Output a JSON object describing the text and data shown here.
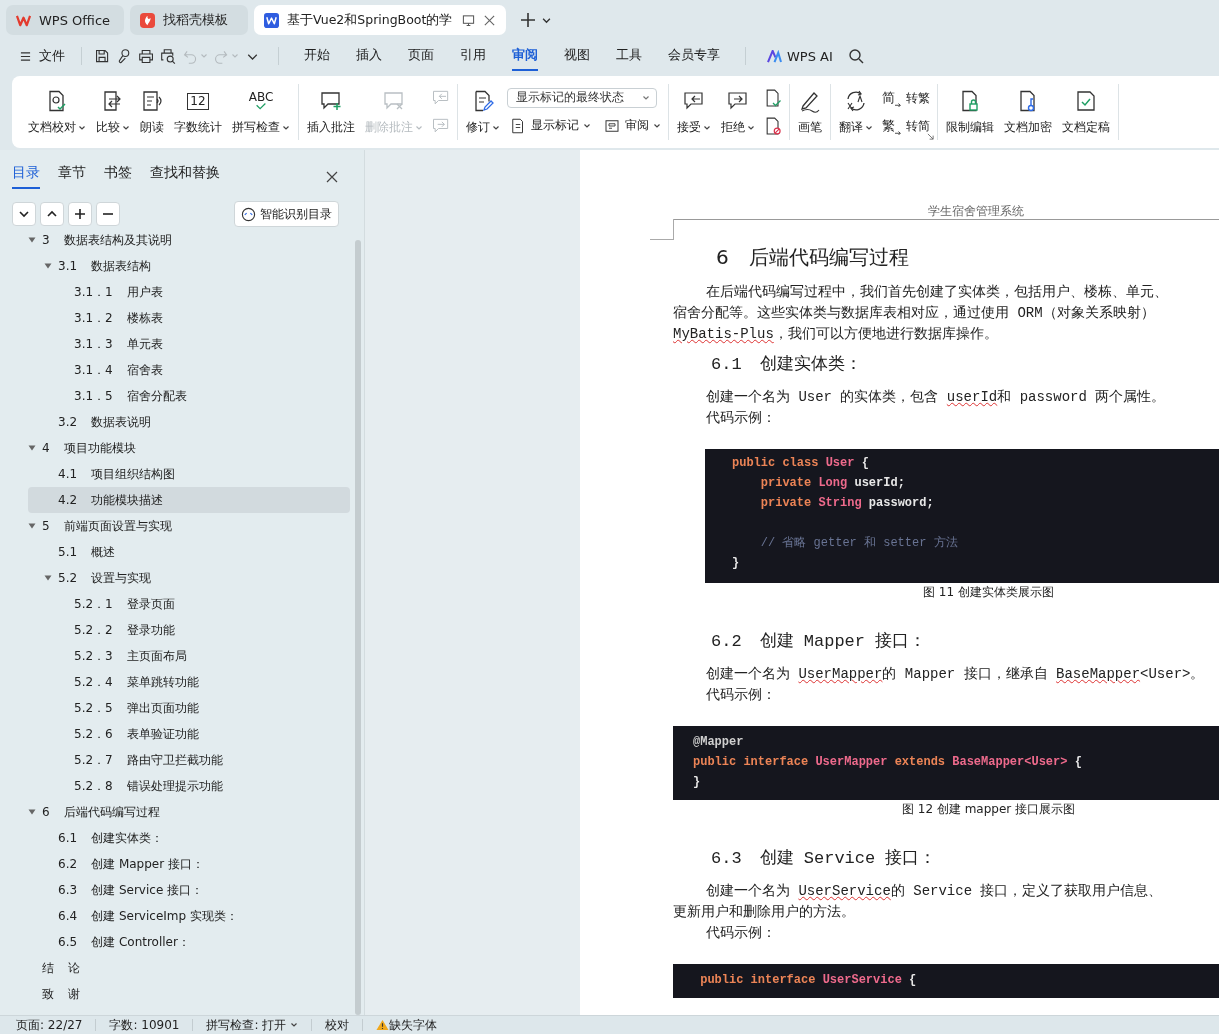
{
  "tabs": [
    {
      "kind": "app",
      "label": "WPS Office",
      "selected": false
    },
    {
      "kind": "template",
      "label": "找稻壳模板",
      "selected": false
    },
    {
      "kind": "writer",
      "label": "基于Vue2和SpringBoot的学",
      "selected": true
    }
  ],
  "menu": {
    "file_label": "文件",
    "quick_access": [
      {
        "disabled": false
      },
      {
        "disabled": false
      },
      {
        "disabled": false
      },
      {
        "disabled": false
      },
      {
        "disabled": true
      },
      {
        "disabled": true
      },
      {
        "disabled": false
      }
    ],
    "tabs": [
      {
        "label": "开始",
        "selected": false
      },
      {
        "label": "插入",
        "selected": false
      },
      {
        "label": "页面",
        "selected": false
      },
      {
        "label": "引用",
        "selected": false
      },
      {
        "label": "审阅",
        "selected": true
      },
      {
        "label": "视图",
        "selected": false
      },
      {
        "label": "工具",
        "selected": false
      },
      {
        "label": "会员专享",
        "selected": false
      }
    ],
    "ai_label": "WPS AI"
  },
  "ribbon": {
    "groups": [
      {
        "launcher": false,
        "columns": [
          [
            [
              {
                "kind": "big",
                "label": "文档校对",
                "caret": true,
                "disabled": false
              }
            ]
          ],
          [
            [
              {
                "kind": "big",
                "label": "比较",
                "caret": true,
                "disabled": false
              }
            ]
          ],
          [
            [
              {
                "kind": "big",
                "label": "朗读",
                "caret": false,
                "disabled": false
              }
            ]
          ],
          [
            [
              {
                "kind": "big",
                "label": "字数统计",
                "icon_text": "12",
                "caret": false,
                "disabled": false
              }
            ]
          ],
          [
            [
              {
                "kind": "big",
                "label": "拼写检查",
                "icon_text": "ABC",
                "caret": true,
                "disabled": false
              }
            ]
          ]
        ]
      },
      {
        "launcher": false,
        "columns": [
          [
            [
              {
                "kind": "big",
                "label": "插入批注",
                "caret": false,
                "disabled": false
              }
            ]
          ],
          [
            [
              {
                "kind": "big",
                "label": "删除批注",
                "caret": true,
                "disabled": true
              }
            ]
          ],
          [
            [
              {
                "kind": "icon",
                "disabled": true
              }
            ],
            [
              {
                "kind": "icon",
                "disabled": true
              }
            ]
          ]
        ]
      },
      {
        "launcher": false,
        "columns": [
          [
            [
              {
                "kind": "big",
                "label": "修订",
                "caret": true,
                "disabled": false
              }
            ]
          ],
          [
            [
              {
                "kind": "select",
                "value": "显示标记的最终状态"
              }
            ],
            [
              {
                "kind": "small",
                "label": "显示标记",
                "caret": true,
                "disabled": false
              },
              {
                "kind": "small",
                "label": "审阅",
                "caret": true,
                "disabled": false
              }
            ]
          ]
        ]
      },
      {
        "launcher": false,
        "columns": [
          [
            [
              {
                "kind": "big",
                "label": "接受",
                "caret": true,
                "disabled": false
              }
            ]
          ],
          [
            [
              {
                "kind": "big",
                "label": "拒绝",
                "caret": true,
                "disabled": false
              }
            ]
          ],
          [
            [
              {
                "kind": "icon",
                "disabled": false
              }
            ],
            [
              {
                "kind": "icon",
                "disabled": false
              }
            ]
          ]
        ]
      },
      {
        "launcher": false,
        "columns": [
          [
            [
              {
                "kind": "big",
                "label": "画笔",
                "caret": false,
                "disabled": false
              }
            ]
          ]
        ]
      },
      {
        "launcher": true,
        "columns": [
          [
            [
              {
                "kind": "big",
                "label": "翻译",
                "caret": true,
                "disabled": false
              }
            ]
          ],
          [
            [
              {
                "kind": "small",
                "label": "转繁",
                "icon_text": "简",
                "caret": false,
                "disabled": false
              }
            ],
            [
              {
                "kind": "small",
                "label": "转简",
                "icon_text": "繁",
                "caret": false,
                "disabled": false
              }
            ]
          ]
        ]
      },
      {
        "launcher": false,
        "columns": [
          [
            [
              {
                "kind": "big",
                "label": "限制编辑",
                "caret": false,
                "disabled": false
              }
            ]
          ],
          [
            [
              {
                "kind": "big",
                "label": "文档加密",
                "caret": false,
                "disabled": false
              }
            ]
          ],
          [
            [
              {
                "kind": "big",
                "label": "文档定稿",
                "caret": false,
                "disabled": false
              }
            ]
          ]
        ]
      }
    ]
  },
  "navigation": {
    "tabs": [
      {
        "label": "目录",
        "selected": true
      },
      {
        "label": "章节",
        "selected": false
      },
      {
        "label": "书签",
        "selected": false
      },
      {
        "label": "查找和替换",
        "selected": false
      }
    ],
    "smart_button": "智能识别目录",
    "outline": [
      {
        "num": "3",
        "title": "数据表结构及其说明",
        "selected": false,
        "expanded": true,
        "children": [
          {
            "num": "3.1",
            "title": "数据表结构",
            "selected": false,
            "expanded": true,
            "children": [
              {
                "num": "3.1．1",
                "title": "用户表",
                "selected": false
              },
              {
                "num": "3.1．2",
                "title": "楼栋表",
                "selected": false
              },
              {
                "num": "3.1．3",
                "title": "单元表",
                "selected": false
              },
              {
                "num": "3.1．4",
                "title": "宿舍表",
                "selected": false
              },
              {
                "num": "3.1．5",
                "title": "宿舍分配表",
                "selected": false
              }
            ]
          },
          {
            "num": "3.2",
            "title": "数据表说明",
            "selected": false
          }
        ]
      },
      {
        "num": "4",
        "title": "项目功能模块",
        "selected": false,
        "expanded": true,
        "children": [
          {
            "num": "4.1",
            "title": "项目组织结构图",
            "selected": false
          },
          {
            "num": "4.2",
            "title": "功能模块描述",
            "selected": true
          }
        ]
      },
      {
        "num": "5",
        "title": "前端页面设置与实现",
        "selected": false,
        "expanded": true,
        "children": [
          {
            "num": "5.1",
            "title": "概述",
            "selected": false
          },
          {
            "num": "5.2",
            "title": "设置与实现",
            "selected": false,
            "expanded": true,
            "children": [
              {
                "num": "5.2．1",
                "title": "登录页面",
                "selected": false
              },
              {
                "num": "5.2．2",
                "title": "登录功能",
                "selected": false
              },
              {
                "num": "5.2．3",
                "title": "主页面布局",
                "selected": false
              },
              {
                "num": "5.2．4",
                "title": "菜单跳转功能",
                "selected": false
              },
              {
                "num": "5.2．5",
                "title": "弹出页面功能",
                "selected": false
              },
              {
                "num": "5.2．6",
                "title": "表单验证功能",
                "selected": false
              },
              {
                "num": "5.2．7",
                "title": "路由守卫拦截功能",
                "selected": false
              },
              {
                "num": "5.2．8",
                "title": "错误处理提示功能",
                "selected": false
              }
            ]
          }
        ]
      },
      {
        "num": "6",
        "title": "后端代码编写过程",
        "selected": false,
        "expanded": true,
        "children": [
          {
            "num": "6.1",
            "title": "创建实体类：",
            "selected": false
          },
          {
            "num": "6.2",
            "title": "创建 Mapper 接口：",
            "selected": false
          },
          {
            "num": "6.3",
            "title": "创建 Service 接口：",
            "selected": false
          },
          {
            "num": "6.4",
            "title": "创建 ServiceImp 实现类：",
            "selected": false
          },
          {
            "num": "6.5",
            "title": "创建 Controller：",
            "selected": false
          }
        ]
      },
      {
        "num": "结",
        "title": "论",
        "selected": false
      },
      {
        "num": "致",
        "title": "谢",
        "selected": false
      }
    ]
  },
  "document": {
    "header": "学生宿舍管理系统",
    "blocks": [
      {
        "kind": "heading1",
        "num": "6",
        "title": "后端代码编写过程"
      },
      {
        "kind": "para",
        "lines": [
          {
            "indented": true,
            "segments": [
              {
                "text": "在后端代码编写过程中，我们首先创建了实体类，包括用户、楼栋、单元、",
                "misspelled": false
              }
            ]
          },
          {
            "indented": false,
            "segments": [
              {
                "text": "宿舍分配等。这些实体类与数据库表相对应，通过使用 ORM（对象关系映射）",
                "misspelled": false
              }
            ]
          },
          {
            "indented": false,
            "segments": [
              {
                "text": "MyBatis-Plus",
                "misspelled": true
              },
              {
                "text": "，我们可以方便地进行数据库操作。",
                "misspelled": false
              }
            ]
          }
        ]
      },
      {
        "kind": "heading2",
        "num": "6.1",
        "title": "创建实体类："
      },
      {
        "kind": "para",
        "lines": [
          {
            "indented": true,
            "segments": [
              {
                "text": "创建一个名为 User 的实体类，包含 ",
                "misspelled": false
              },
              {
                "text": "userId",
                "misspelled": true
              },
              {
                "text": "和 password 两个属性。",
                "misspelled": false
              }
            ]
          },
          {
            "indented": true,
            "segments": [
              {
                "text": "代码示例：",
                "misspelled": false
              }
            ]
          }
        ]
      },
      {
        "kind": "code",
        "indented": true,
        "lines": [
          {
            "kind": "code",
            "tokens": [
              {
                "text": "public class ",
                "kind": "keyword"
              },
              {
                "text": "User",
                "kind": "type"
              },
              {
                "text": " {",
                "kind": "plain"
              }
            ]
          },
          {
            "kind": "code",
            "tokens": [
              {
                "text": "    private ",
                "kind": "keyword"
              },
              {
                "text": "Long",
                "kind": "type"
              },
              {
                "text": " userId;",
                "kind": "plain"
              }
            ]
          },
          {
            "kind": "code",
            "tokens": [
              {
                "text": "    private ",
                "kind": "keyword"
              },
              {
                "text": "String",
                "kind": "type"
              },
              {
                "text": " password;",
                "kind": "plain"
              }
            ]
          },
          {
            "kind": "blank"
          },
          {
            "kind": "code",
            "tokens": [
              {
                "text": "    // 省略 getter 和 setter 方法",
                "kind": "comment"
              }
            ]
          },
          {
            "kind": "code",
            "tokens": [
              {
                "text": "}",
                "kind": "plain"
              }
            ]
          }
        ]
      },
      {
        "kind": "caption",
        "text": "图  11 创建实体类展示图"
      },
      {
        "kind": "heading2",
        "num": "6.2",
        "title": "创建 Mapper 接口："
      },
      {
        "kind": "para",
        "lines": [
          {
            "indented": true,
            "segments": [
              {
                "text": "创建一个名为 ",
                "misspelled": false
              },
              {
                "text": "UserMapper",
                "misspelled": true
              },
              {
                "text": "的 Mapper 接口，继承自 ",
                "misspelled": false
              },
              {
                "text": "BaseMapper",
                "misspelled": true
              },
              {
                "text": "<User>。",
                "misspelled": false
              }
            ]
          },
          {
            "indented": true,
            "segments": [
              {
                "text": "代码示例：",
                "misspelled": false
              }
            ]
          }
        ]
      },
      {
        "kind": "code",
        "indented": false,
        "lines": [
          {
            "kind": "code",
            "tokens": [
              {
                "text": "@Mapper",
                "kind": "annotation"
              }
            ]
          },
          {
            "kind": "code",
            "tokens": [
              {
                "text": "public interface ",
                "kind": "keyword"
              },
              {
                "text": "UserMapper ",
                "kind": "type"
              },
              {
                "text": "extends ",
                "kind": "keyword"
              },
              {
                "text": "BaseMapper<User>",
                "kind": "type"
              },
              {
                "text": " {",
                "kind": "plain"
              }
            ]
          },
          {
            "kind": "code",
            "tokens": [
              {
                "text": "}",
                "kind": "plain"
              }
            ]
          }
        ]
      },
      {
        "kind": "caption",
        "text": "图  12 创建 mapper 接口展示图"
      },
      {
        "kind": "heading2",
        "num": "6.3",
        "title": "创建 Service 接口："
      },
      {
        "kind": "para",
        "lines": [
          {
            "indented": true,
            "segments": [
              {
                "text": "创建一个名为 ",
                "misspelled": false
              },
              {
                "text": "UserService",
                "misspelled": true
              },
              {
                "text": "的 Service 接口，定义了获取用户信息、",
                "misspelled": false
              }
            ]
          },
          {
            "indented": false,
            "segments": [
              {
                "text": "更新用户和删除用户的方法。",
                "misspelled": false
              }
            ]
          },
          {
            "indented": true,
            "segments": [
              {
                "text": "代码示例：",
                "misspelled": false
              }
            ]
          }
        ]
      },
      {
        "kind": "code",
        "indented": false,
        "lines": [
          {
            "kind": "code",
            "tokens": [
              {
                "text": " public interface ",
                "kind": "keyword"
              },
              {
                "text": "UserService",
                "kind": "type"
              },
              {
                "text": " {",
                "kind": "plain"
              }
            ]
          }
        ]
      }
    ]
  },
  "status_bar": [
    {
      "kind": "text",
      "text": "页面: 22/27"
    },
    {
      "kind": "text",
      "text": "字数: 10901"
    },
    {
      "kind": "dropdown",
      "text": "拼写检查: 打开"
    },
    {
      "kind": "text",
      "text": "校对"
    },
    {
      "kind": "warning",
      "text": "缺失字体"
    }
  ]
}
